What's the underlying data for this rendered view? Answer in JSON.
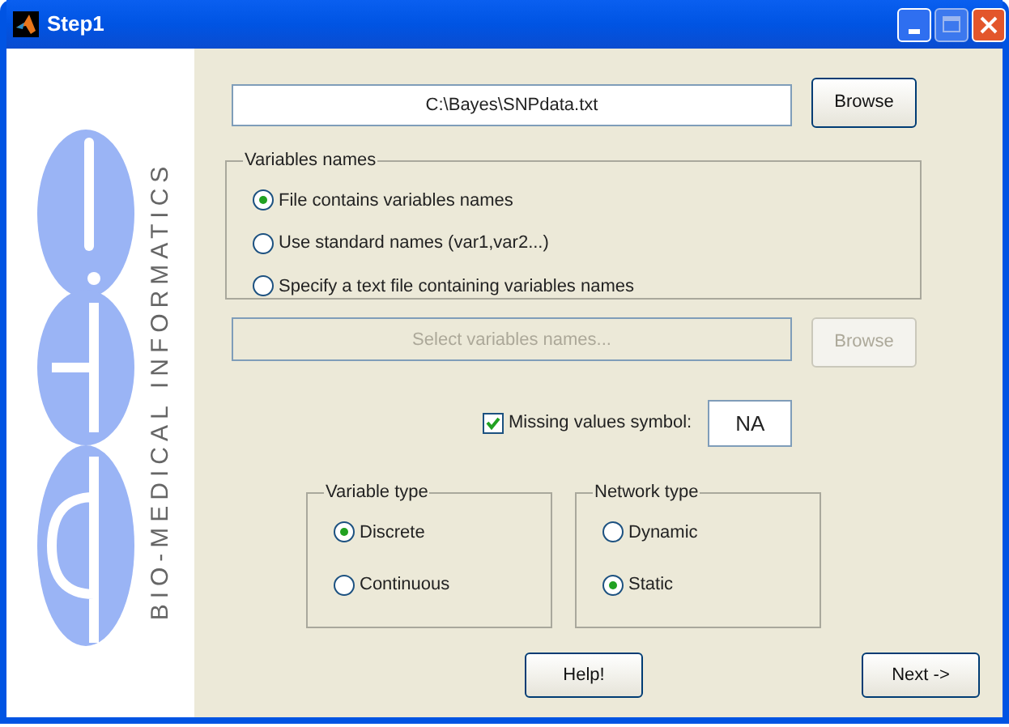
{
  "window": {
    "title": "Step1"
  },
  "logo": {
    "caption": "BIO-MEDICAL INFORMATICS"
  },
  "data_file": {
    "value": "C:\\Bayes\\SNPdata.txt",
    "browse": {
      "label": "Browse",
      "disabled": false
    }
  },
  "variables_names": {
    "title": "Variables names",
    "options": [
      {
        "label": "File contains variables names",
        "selected": true
      },
      {
        "label": "Use standard names (var1,var2...)",
        "selected": false
      },
      {
        "label": "Specify a text file containing variables names",
        "selected": false
      }
    ]
  },
  "names_file": {
    "placeholder": "Select variables names...",
    "disabled": true,
    "browse": {
      "label": "Browse",
      "disabled": true
    }
  },
  "missing_values": {
    "label": "Missing values symbol:",
    "checked": true,
    "value": "NA"
  },
  "variable_type": {
    "title": "Variable type",
    "options": [
      {
        "label": "Discrete",
        "selected": true
      },
      {
        "label": "Continuous",
        "selected": false
      }
    ]
  },
  "network_type": {
    "title": "Network type",
    "options": [
      {
        "label": "Dynamic",
        "selected": false
      },
      {
        "label": "Static",
        "selected": true
      }
    ]
  },
  "buttons": [
    {
      "label": "Help!"
    },
    {
      "label": "Next ->"
    }
  ]
}
